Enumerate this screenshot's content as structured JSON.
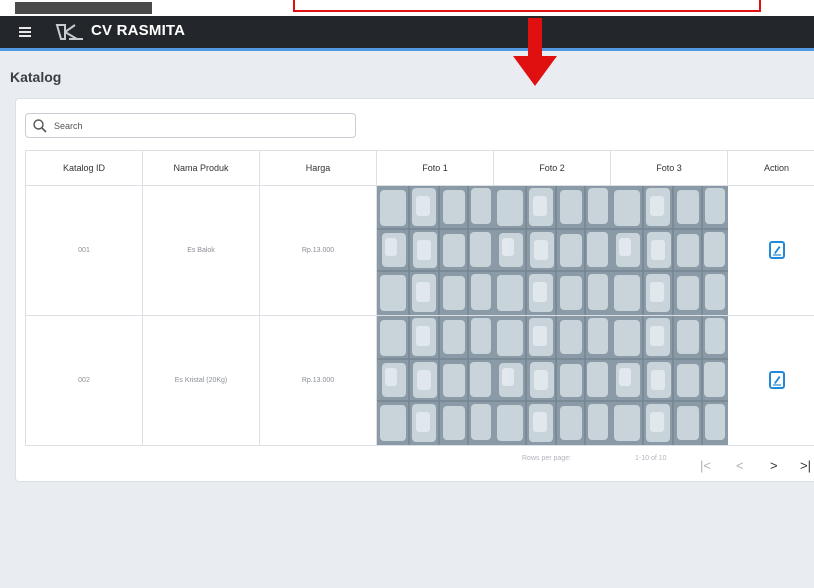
{
  "app": {
    "brand": "CV RASMITA"
  },
  "page": {
    "title": "Katalog"
  },
  "search": {
    "placeholder": "Search"
  },
  "table": {
    "headers": [
      "Katalog ID",
      "Nama Produk",
      "Harga",
      "Foto 1",
      "Foto 2",
      "Foto 3",
      "Action"
    ],
    "rows": [
      {
        "id": "001",
        "name": "Es Balok",
        "price": "Rp.13.000"
      },
      {
        "id": "002",
        "name": "Es Kristal (20Kg)",
        "price": "Rp.13.000"
      }
    ]
  },
  "pagination": {
    "rows_per_page_label": "Rows per page:",
    "range": "1-10 of 10",
    "first": "|<",
    "prev": "<",
    "next": ">",
    "last": ">|"
  },
  "colors": {
    "appbar": "#23262b",
    "accent": "#4f9ae0",
    "edit_icon": "#2289d8",
    "annotation_red": "#e01010"
  }
}
